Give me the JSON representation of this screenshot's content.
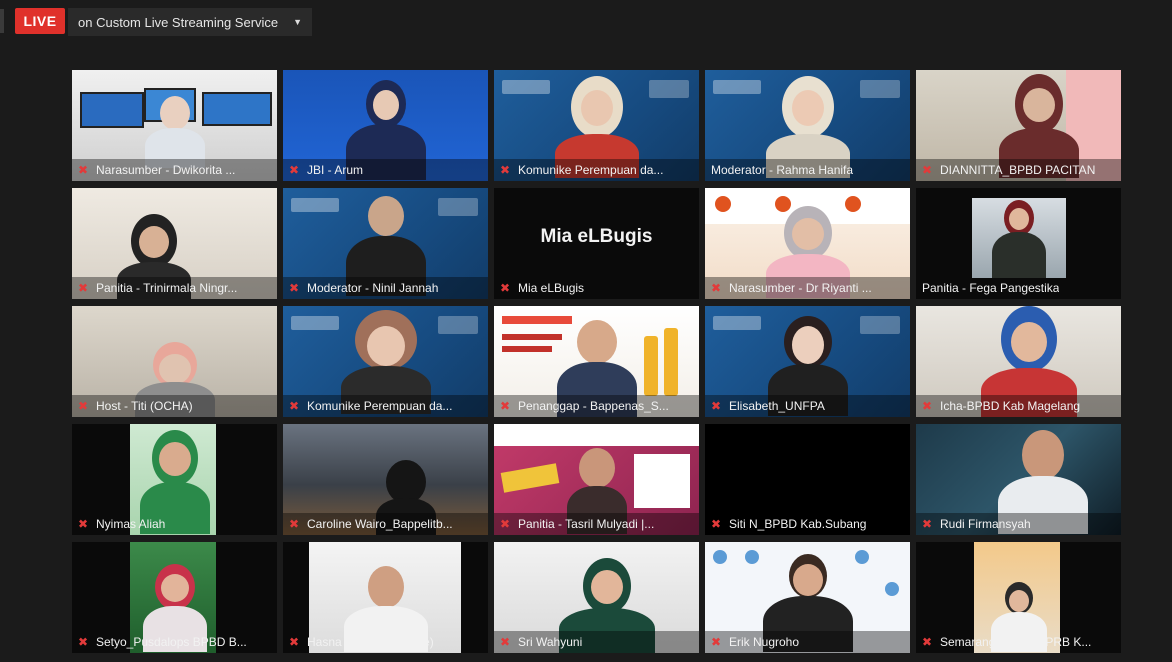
{
  "topbar": {
    "live_label": "LIVE",
    "stream_target": "on Custom Live Streaming Service"
  },
  "participants": [
    {
      "name": "Narasumber - Dwikorita ...",
      "muted": true
    },
    {
      "name": "JBI - Arum",
      "muted": true
    },
    {
      "name": "Komunike Perempuan da...",
      "muted": true
    },
    {
      "name": "Moderator - Rahma Hanifa",
      "muted": false,
      "active_speaker": true
    },
    {
      "name": "DIANNITTA_BPBD PACITAN",
      "muted": true
    },
    {
      "name": "Panitia - Trinirmala Ningr...",
      "muted": true
    },
    {
      "name": "Moderator - Ninil Jannah",
      "muted": true
    },
    {
      "name": "Mia eLBugis",
      "muted": true,
      "video_off_label": "Mia eLBugis"
    },
    {
      "name": "Narasumber - Dr Riyanti ...",
      "muted": true
    },
    {
      "name": "Panitia - Fega Pangestika",
      "muted": false
    },
    {
      "name": "Host - Titi (OCHA)",
      "muted": true
    },
    {
      "name": "Komunike Perempuan da...",
      "muted": true
    },
    {
      "name": "Penanggap - Bappenas_S...",
      "muted": true
    },
    {
      "name": "Elisabeth_UNFPA",
      "muted": true
    },
    {
      "name": "Icha-BPBD Kab Magelang",
      "muted": true
    },
    {
      "name": "Nyimas Aliah",
      "muted": true
    },
    {
      "name": "Caroline Wairo_Bappelitb...",
      "muted": true
    },
    {
      "name": "Panitia - Tasril Mulyadi |...",
      "muted": true
    },
    {
      "name": "Siti N_BPBD Kab.Subang",
      "muted": true
    },
    {
      "name": "Rudi Firmansyah",
      "muted": true
    },
    {
      "name": "Setyo_Pusdalops BPBD B...",
      "muted": true
    },
    {
      "name": "Hasna (sekdes Malaue)",
      "muted": true
    },
    {
      "name": "Sri Wahyuni",
      "muted": true
    },
    {
      "name": "Erik Nugroho",
      "muted": true
    },
    {
      "name": "Semarang Pertiwi FPRB K...",
      "muted": true
    }
  ],
  "colors": {
    "background": "#1b1b1b",
    "live_red": "#e0312b",
    "speaker_highlight": "#c8e04a",
    "muted_icon": "#e23a3a"
  },
  "icons": {
    "muted": "mic-off-icon",
    "caret": "chevron-down-icon"
  }
}
